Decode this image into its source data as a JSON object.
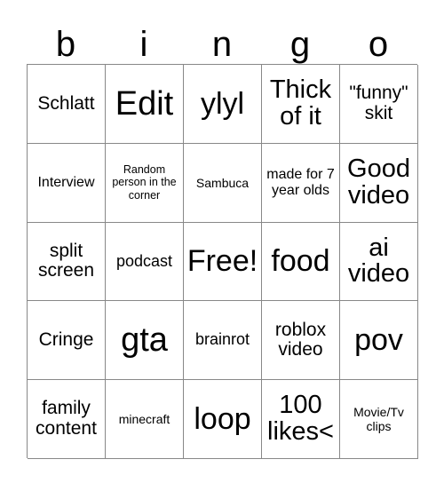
{
  "card": {
    "header_letters": [
      "b",
      "i",
      "n",
      "g",
      "o"
    ],
    "columns": 5,
    "rows": 5,
    "border_color": "#888888",
    "cell_background": "#ffffff",
    "text_color": "#000000",
    "free_space": {
      "row": 3,
      "column": 3,
      "label": "Free!"
    },
    "cells": [
      {
        "r": 1,
        "c": 1,
        "text": "Schlatt",
        "size": "ml"
      },
      {
        "r": 1,
        "c": 2,
        "text": "Edit",
        "size": "huge"
      },
      {
        "r": 1,
        "c": 3,
        "text": "ylyl",
        "size": "xxl"
      },
      {
        "r": 1,
        "c": 4,
        "text": "Thick of it",
        "size": "xl"
      },
      {
        "r": 1,
        "c": 5,
        "text": "\"funny\" skit",
        "size": "ml"
      },
      {
        "r": 2,
        "c": 1,
        "text": "Interview",
        "size": "sm"
      },
      {
        "r": 2,
        "c": 2,
        "text": "Random person in the corner",
        "size": "xs"
      },
      {
        "r": 2,
        "c": 3,
        "text": "Sambuca",
        "size": "s"
      },
      {
        "r": 2,
        "c": 4,
        "text": "made for 7 year olds",
        "size": "sm"
      },
      {
        "r": 2,
        "c": 5,
        "text": "Good video",
        "size": "xl"
      },
      {
        "r": 3,
        "c": 1,
        "text": "split screen",
        "size": "ml"
      },
      {
        "r": 3,
        "c": 2,
        "text": "podcast",
        "size": "m"
      },
      {
        "r": 3,
        "c": 3,
        "text": "Free!",
        "size": "xxl"
      },
      {
        "r": 3,
        "c": 4,
        "text": "food",
        "size": "xxl"
      },
      {
        "r": 3,
        "c": 5,
        "text": "ai video",
        "size": "xl"
      },
      {
        "r": 4,
        "c": 1,
        "text": "Cringe",
        "size": "ml"
      },
      {
        "r": 4,
        "c": 2,
        "text": "gta",
        "size": "huge"
      },
      {
        "r": 4,
        "c": 3,
        "text": "brainrot",
        "size": "m"
      },
      {
        "r": 4,
        "c": 4,
        "text": "roblox video",
        "size": "ml"
      },
      {
        "r": 4,
        "c": 5,
        "text": "pov",
        "size": "xxl"
      },
      {
        "r": 5,
        "c": 1,
        "text": "family content",
        "size": "ml"
      },
      {
        "r": 5,
        "c": 2,
        "text": "minecraft",
        "size": "s"
      },
      {
        "r": 5,
        "c": 3,
        "text": "loop",
        "size": "xxl"
      },
      {
        "r": 5,
        "c": 4,
        "text": "100 likes<",
        "size": "xl"
      },
      {
        "r": 5,
        "c": 5,
        "text": "Movie/Tv clips",
        "size": "s"
      }
    ]
  }
}
